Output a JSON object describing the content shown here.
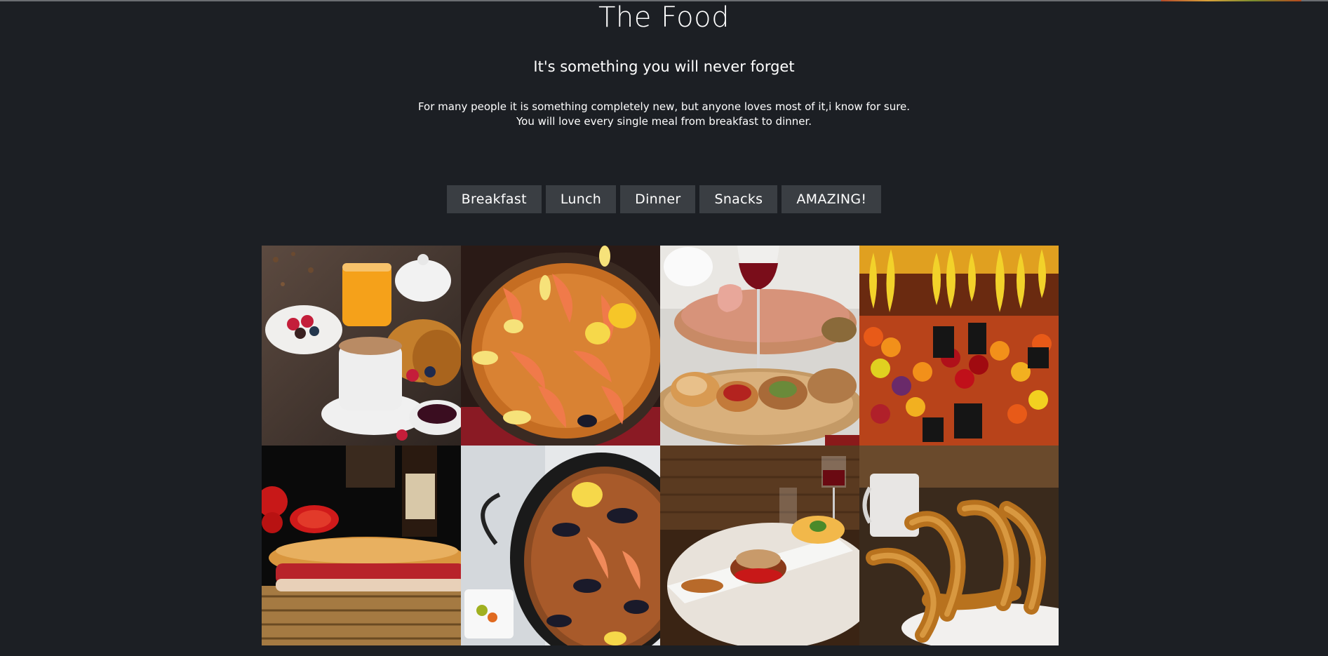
{
  "header": {
    "title": "The Food",
    "subtitle": "It's something you will never forget",
    "description_line1": "For many people it is something completely new, but anyone loves most of it,i know for sure.",
    "description_line2": "You will love every single meal from breakfast to dinner."
  },
  "nav": {
    "buttons": [
      "Breakfast",
      "Lunch",
      "Dinner",
      "Snacks",
      "AMAZING!"
    ]
  },
  "gallery": {
    "tiles": [
      "breakfast-coffee-croissants",
      "seafood-paella-lemons",
      "tapas-wine-glass",
      "market-fruit-stand",
      "jamon-baguette-tomatoes",
      "paella-pan-mussels",
      "plated-dinner-wine",
      "churros-with-cup"
    ]
  },
  "colors": {
    "background": "#1c1f24",
    "button": "#3a3e43",
    "text": "#ffffff"
  }
}
